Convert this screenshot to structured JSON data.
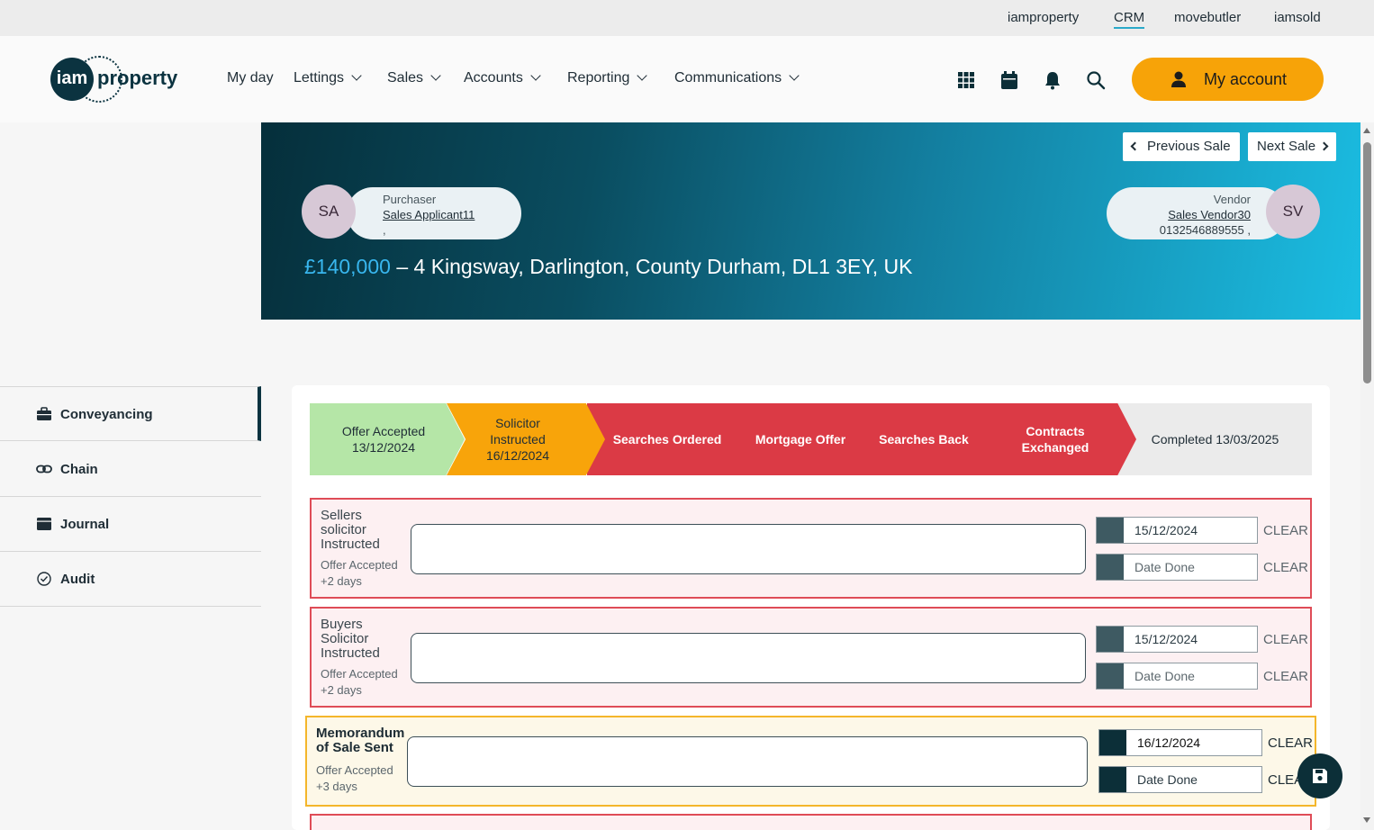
{
  "topbar": {
    "links": [
      "iamproperty",
      "CRM",
      "movebutler",
      "iamsold"
    ],
    "active": "CRM"
  },
  "header": {
    "logo": {
      "circle": "iam",
      "text": "property"
    },
    "nav": [
      "My day",
      "Lettings",
      "Sales",
      "Accounts",
      "Reporting",
      "Communications"
    ],
    "icons": [
      "apps-grid-icon",
      "calendar-icon",
      "bell-icon",
      "search-icon"
    ],
    "account_label": "My account",
    "accent": "#f7a308"
  },
  "sidebar": {
    "items": [
      {
        "label": "Conveyancing",
        "icon": "briefcase-icon",
        "active": true
      },
      {
        "label": "Chain",
        "icon": "link-icon",
        "active": false
      },
      {
        "label": "Journal",
        "icon": "journal-icon",
        "active": false
      },
      {
        "label": "Audit",
        "icon": "check-circle-icon",
        "active": false
      }
    ]
  },
  "banner": {
    "prev_label": "Previous Sale",
    "next_label": "Next Sale",
    "purchaser": {
      "initials": "SA",
      "role": "Purchaser",
      "name": "Sales Applicant11",
      "extra": ","
    },
    "vendor": {
      "initials": "SV",
      "role": "Vendor",
      "name": "Sales Vendor30",
      "phone": "0132546889555 ,"
    },
    "price": "£140,000",
    "address": " – 4 Kingsway, Darlington, County Durham, DL1 3EY, UK"
  },
  "progress": {
    "steps": [
      {
        "line1": "Offer Accepted",
        "line2": "13/12/2024",
        "line3": "",
        "status": "done"
      },
      {
        "line1": "Solicitor",
        "line2": "Instructed",
        "line3": "16/12/2024",
        "status": "current"
      },
      {
        "line1": "Searches Ordered",
        "line2": "",
        "line3": "",
        "status": "pending"
      },
      {
        "line1": "Mortgage Offer",
        "line2": "",
        "line3": "",
        "status": "pending"
      },
      {
        "line1": "Searches Back",
        "line2": "",
        "line3": "",
        "status": "pending"
      },
      {
        "line1": "Contracts",
        "line2": "Exchanged",
        "line3": "",
        "status": "pending"
      },
      {
        "line1": "Completed 13/03/2025",
        "line2": "",
        "line3": "",
        "status": "future"
      }
    ]
  },
  "tasks": [
    {
      "title_lines": [
        "Sellers",
        "solicitor",
        "Instructed"
      ],
      "trigger": "Offer Accepted",
      "offset": "+2 days",
      "due_date": "15/12/2024",
      "done_placeholder": "Date Done",
      "clear_label": "CLEAR",
      "state": "overdue"
    },
    {
      "title_lines": [
        "Buyers",
        "Solicitor",
        "Instructed"
      ],
      "trigger": "Offer Accepted",
      "offset": "+2 days",
      "due_date": "15/12/2024",
      "done_placeholder": "Date Done",
      "clear_label": "CLEAR",
      "state": "overdue"
    },
    {
      "title_lines": [
        "Memorandum",
        "of Sale Sent"
      ],
      "trigger": "Offer Accepted",
      "offset": "+3 days",
      "due_date": "16/12/2024",
      "done_placeholder": "Date Done",
      "clear_label": "CLEAR",
      "state": "due"
    }
  ],
  "fab_icon": "save-icon"
}
